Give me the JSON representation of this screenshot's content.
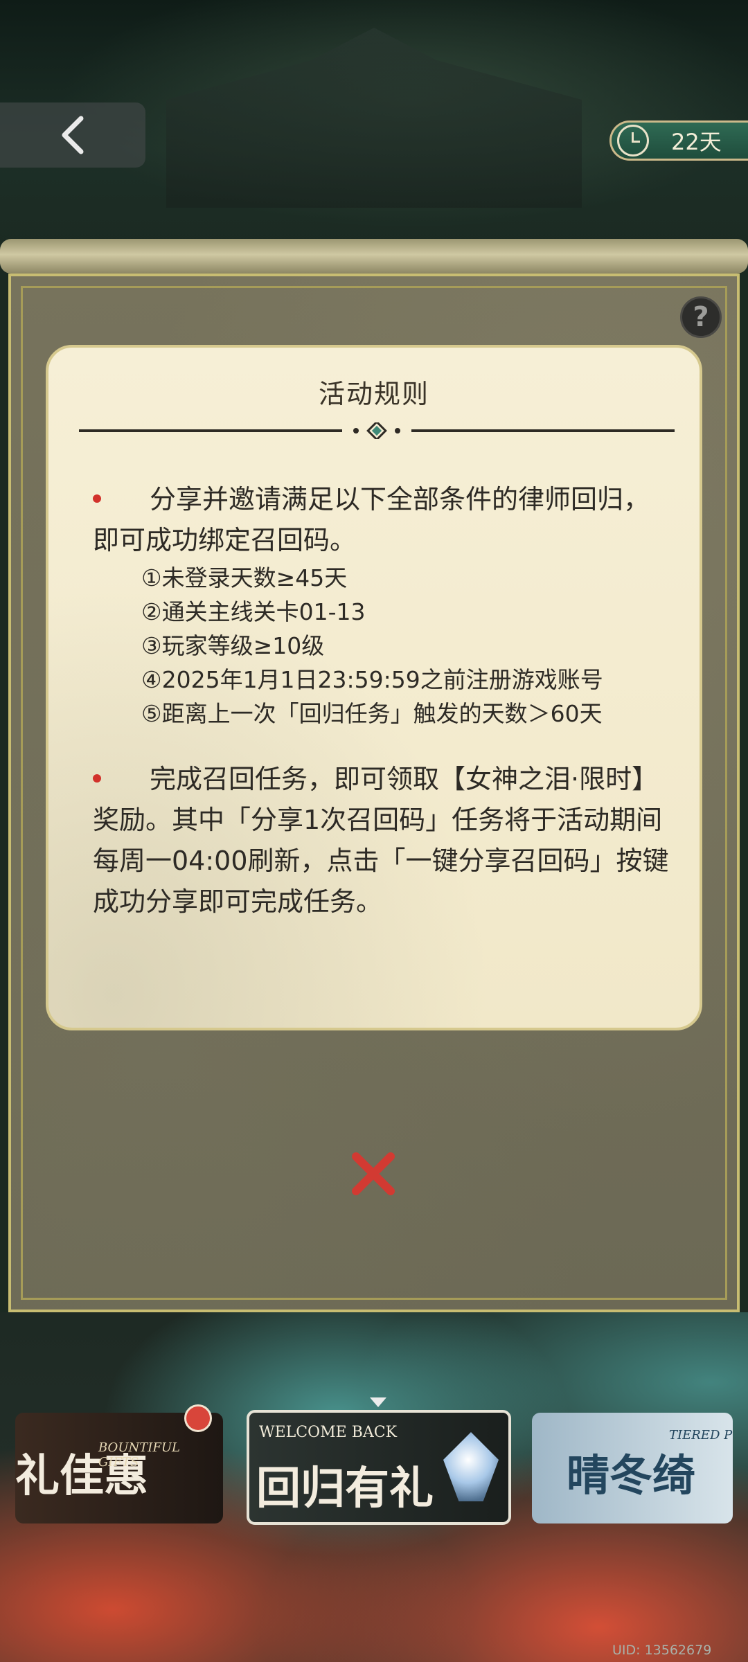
{
  "header": {
    "timer_text": "22天"
  },
  "rules": {
    "title": "活动规则",
    "rule1_text": "分享并邀请满足以下全部条件的律师回归，即可成功绑定召回码。",
    "conditions": [
      "①未登录天数≥45天",
      "②通关主线关卡01-13",
      "③玩家等级≥10级",
      "④2025年1月1日23:59:59之前注册游戏账号",
      "⑤距离上一次「回归任务」触发的天数＞60天"
    ],
    "rule2_text": "完成召回任务，即可领取【女神之泪·限时】奖励。其中「分享1次召回码」任务将于活动期间每周一04:00刷新，点击「一键分享召回码」按键成功分享即可完成任务。"
  },
  "banners": [
    {
      "main": "礼佳惠",
      "sub": "BOUNTIFUL GIFTS"
    },
    {
      "main": "回归有礼",
      "sub": "WELCOME BACK"
    },
    {
      "main": "晴冬绮",
      "sub": "TIERED P"
    }
  ],
  "footer": {
    "uid": "UID: 13562679"
  },
  "colors": {
    "accent_red": "#d2322b",
    "card_bg": "#f4ecd0",
    "panel_bg": "#716e59",
    "timer_green": "#2a5e4a"
  }
}
